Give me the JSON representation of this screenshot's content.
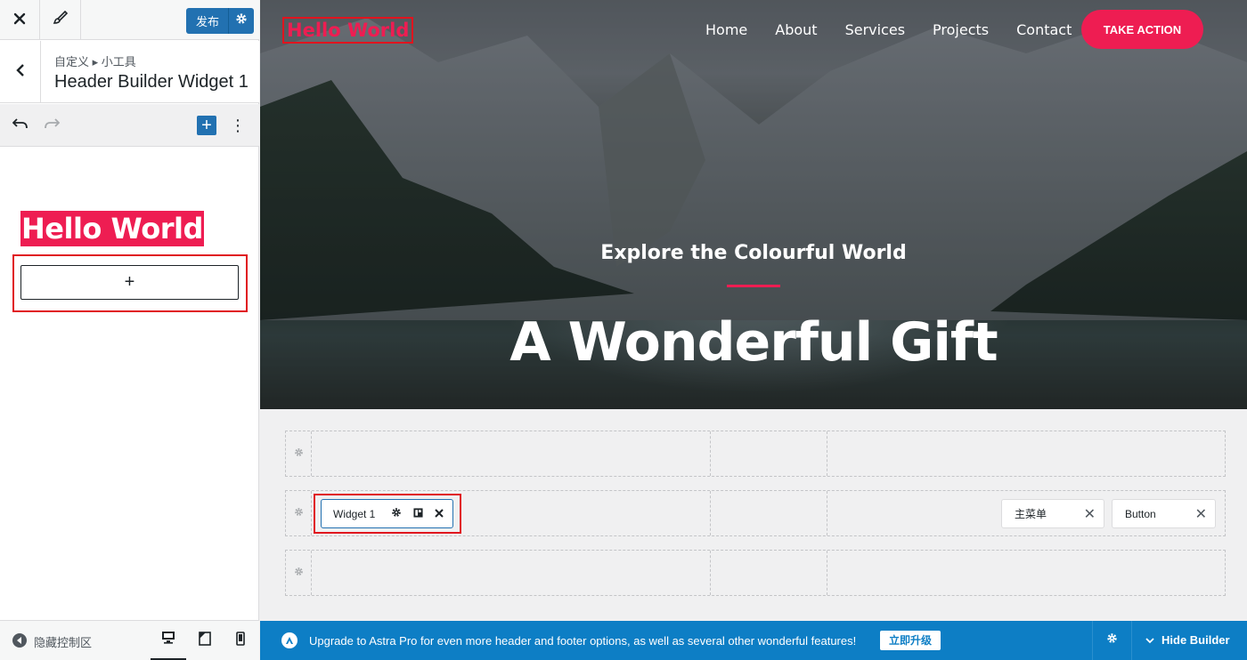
{
  "customizer": {
    "publish_label": "发布",
    "breadcrumb": "自定义 ▸ 小工具",
    "section_title": "Header Builder Widget 1",
    "block_title": "Hello World",
    "add_block_symbol": "+",
    "appender_symbol": "+",
    "more_symbol": "⋮",
    "hide_controls_label": "隐藏控制区"
  },
  "preview": {
    "site_logo": "Hello World",
    "nav": [
      "Home",
      "About",
      "Services",
      "Projects",
      "Contact"
    ],
    "cta_label": "TAKE ACTION",
    "hero_subtitle": "Explore the Colourful World",
    "hero_title": "A Wonderful Gift"
  },
  "builder": {
    "widget_label": "Widget 1",
    "menu_item_label": "主菜单",
    "button_item_label": "Button",
    "remove_symbol": "✕"
  },
  "upgrade_bar": {
    "message": "Upgrade to Astra Pro for even more header and footer options, as well as several other wonderful features!",
    "upgrade_button": "立即升级",
    "hide_builder_label": "Hide Builder"
  },
  "colors": {
    "accent_pink": "#ee1d52",
    "wp_blue": "#2271b1",
    "astra_blue": "#0d7ec5",
    "highlight_red": "#e0141e"
  }
}
